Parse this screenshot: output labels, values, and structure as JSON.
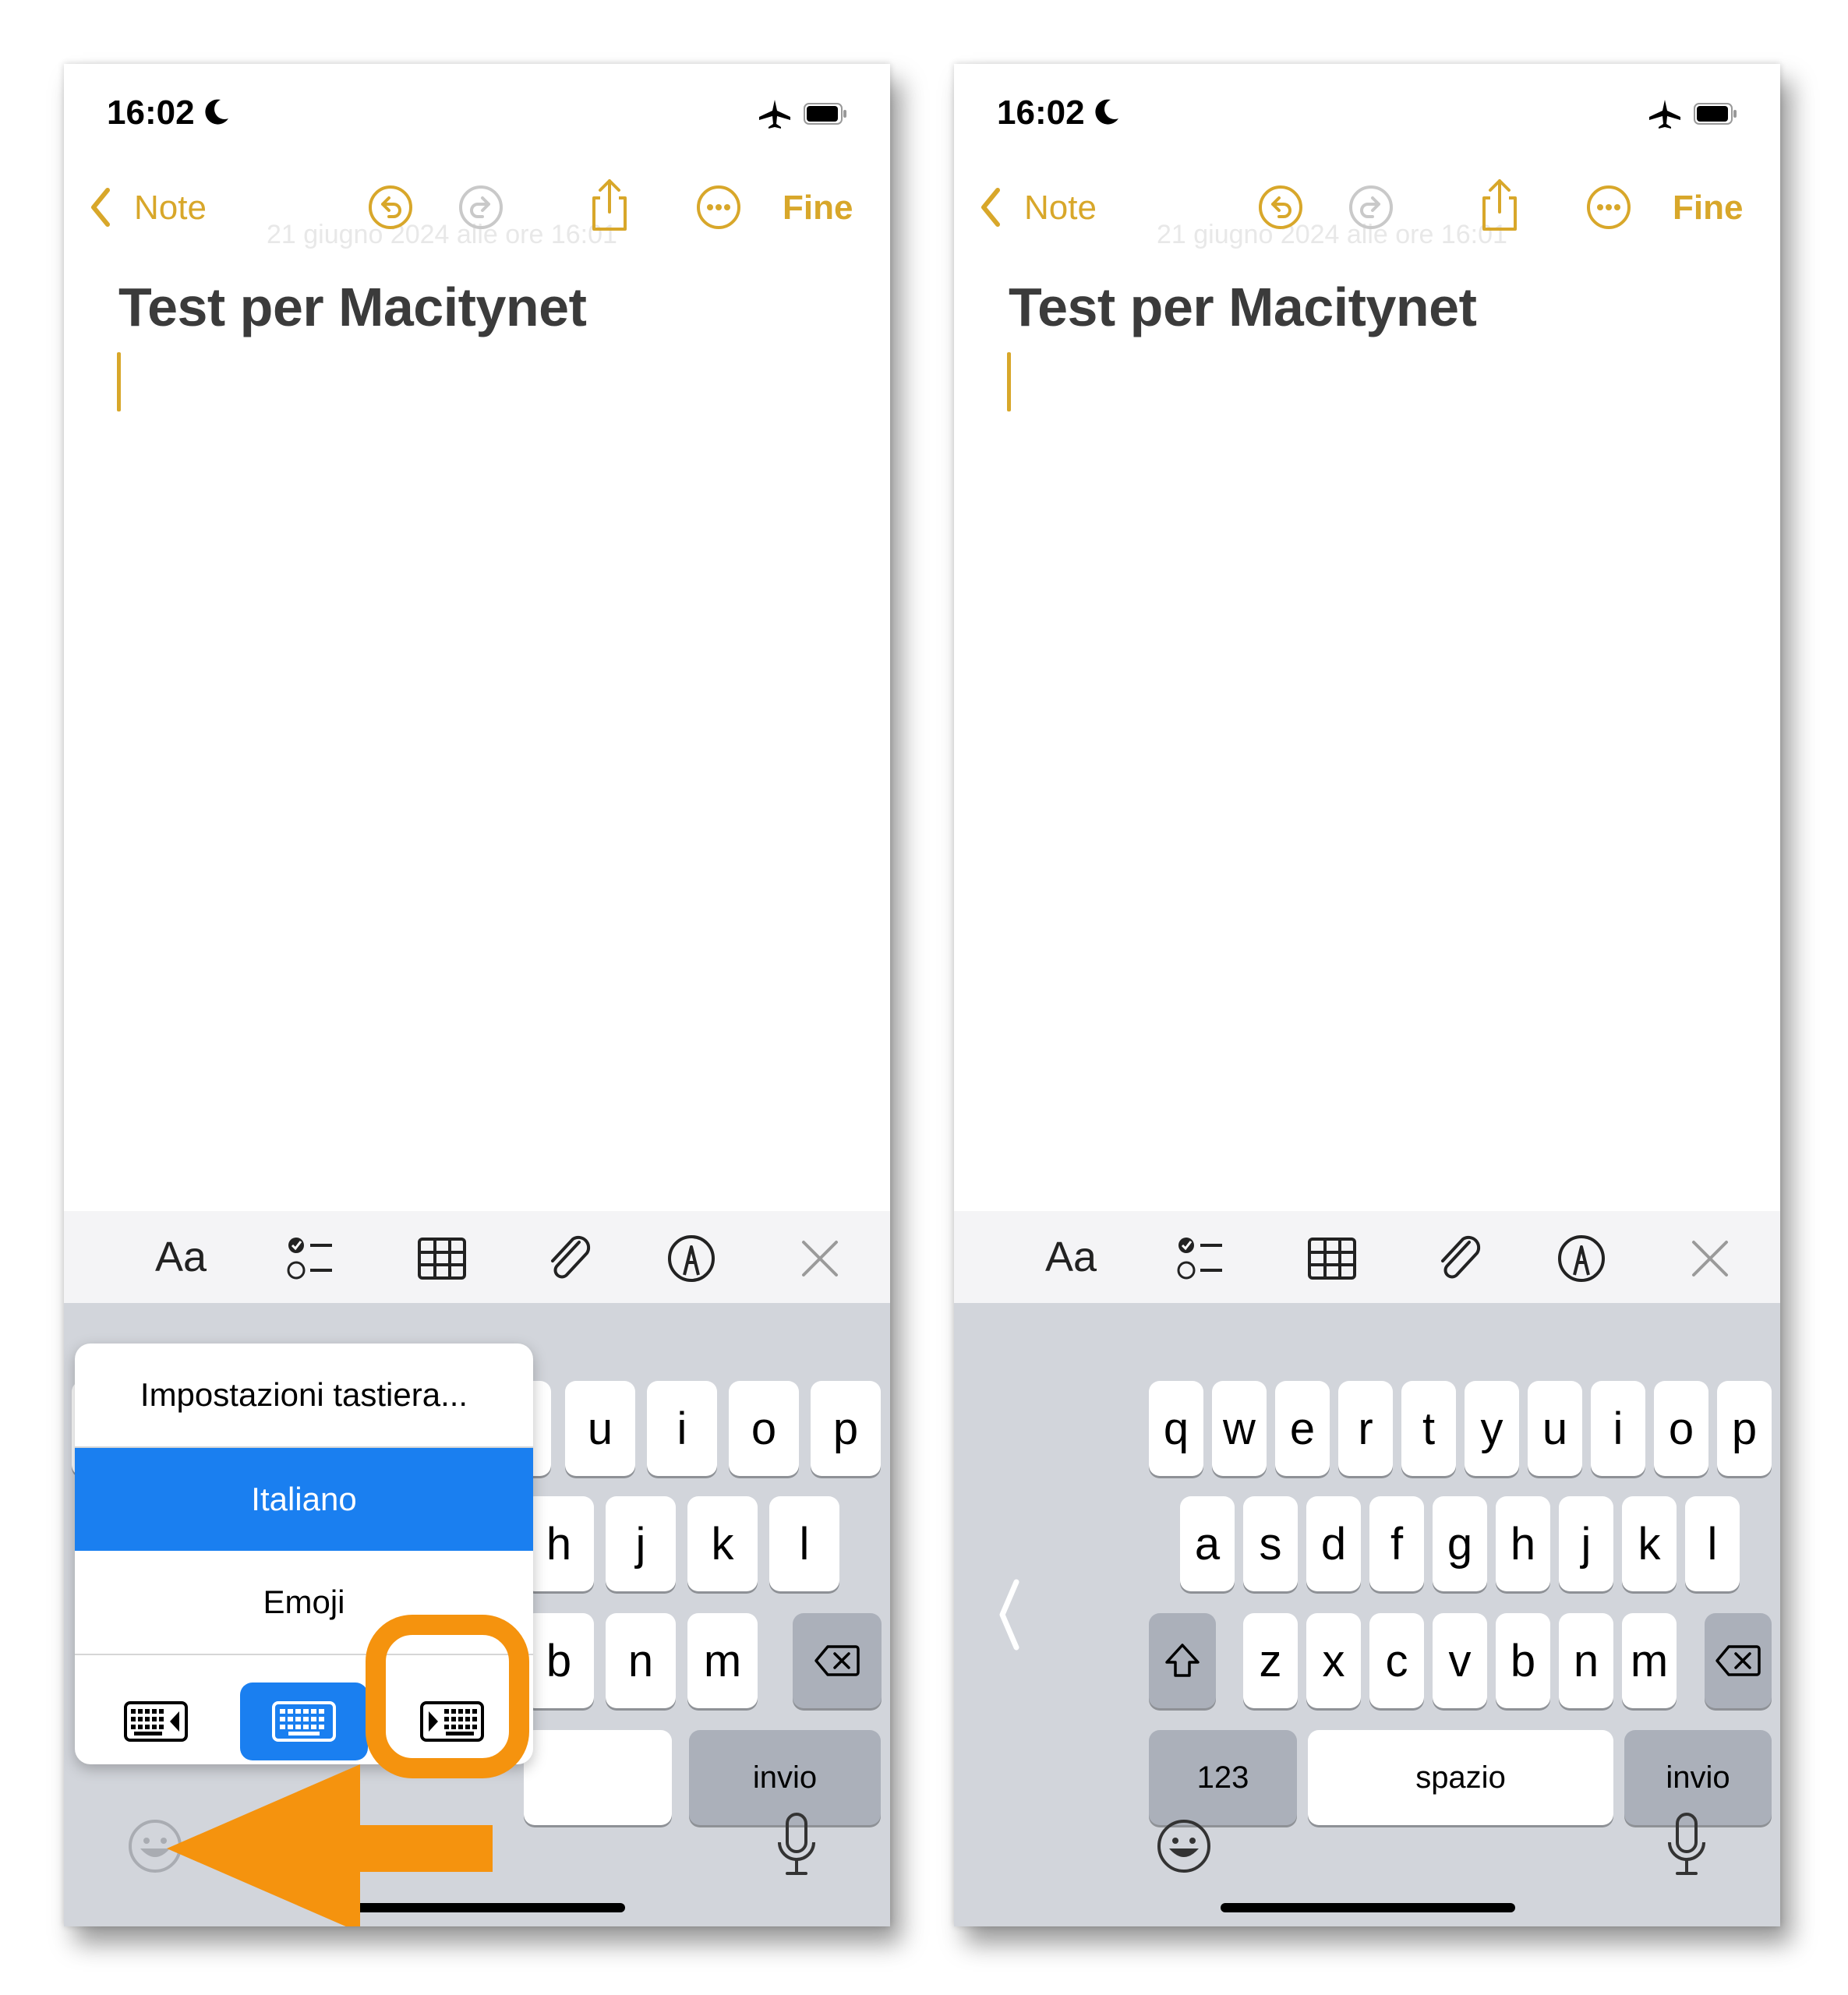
{
  "status": {
    "time": "16:02"
  },
  "nav": {
    "back_label": "Note",
    "done_label": "Fine",
    "ghost_date": "21 giugno 2024 alle ore 16:01"
  },
  "note": {
    "title": "Test per Macitynet"
  },
  "toolbar": {
    "format_label": "Aa"
  },
  "left_phone": {
    "popup": {
      "settings_label": "Impostazioni tastiera...",
      "language_label": "Italiano",
      "emoji_label": "Emoji"
    },
    "row1": [
      "u",
      "i",
      "o",
      "p"
    ],
    "row2": [
      "h",
      "j",
      "k",
      "l"
    ],
    "row3": [
      "b",
      "n",
      "m"
    ],
    "return_label": "invio"
  },
  "right_phone": {
    "row1": [
      "q",
      "w",
      "e",
      "r",
      "t",
      "y",
      "u",
      "i",
      "o",
      "p"
    ],
    "row2": [
      "a",
      "s",
      "d",
      "f",
      "g",
      "h",
      "j",
      "k",
      "l"
    ],
    "row3": [
      "z",
      "x",
      "c",
      "v",
      "b",
      "n",
      "m"
    ],
    "numbers_label": "123",
    "space_label": "spazio",
    "return_label": "invio"
  },
  "colors": {
    "accent": "#d8a72a",
    "highlight": "#f5930e",
    "selection": "#1a7ff0",
    "keyboard_bg": "#d2d5db"
  }
}
